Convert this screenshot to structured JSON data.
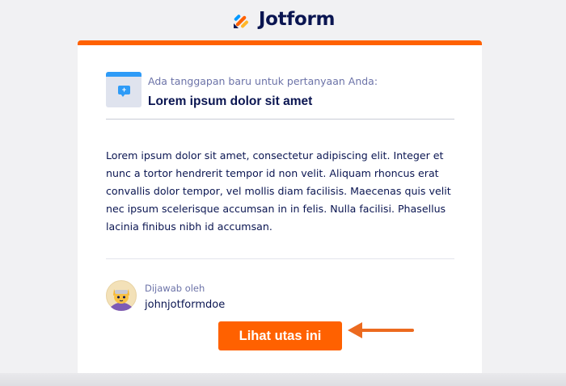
{
  "brand": {
    "name": "Jotform"
  },
  "colors": {
    "accent": "#ff6100",
    "text": "#0a1551",
    "muted": "#6c73a8",
    "icon_blue": "#2e9bf7"
  },
  "question": {
    "label": "Ada tanggapan baru untuk pertanyaan Anda:",
    "title": "Lorem ipsum dolor sit amet",
    "icon": "chat-window-icon"
  },
  "body": {
    "text": "Lorem ipsum dolor sit amet, consectetur adipiscing elit. Integer et nunc a tortor hendrerit tempor id non velit. Aliquam rhoncus erat convallis dolor tempor, vel mollis diam facilisis. Maecenas quis velit nec ipsum scelerisque accumsan in in felis. Nulla facilisi. Phasellus lacinia finibus nibh id accumsan."
  },
  "answer": {
    "label": "Dijawab oleh",
    "username": "johnjotformdoe",
    "avatar_icon": "cat-avatar-icon"
  },
  "cta": {
    "label": "Lihat utas ini"
  },
  "annotation": {
    "icon": "arrow-left-icon"
  }
}
